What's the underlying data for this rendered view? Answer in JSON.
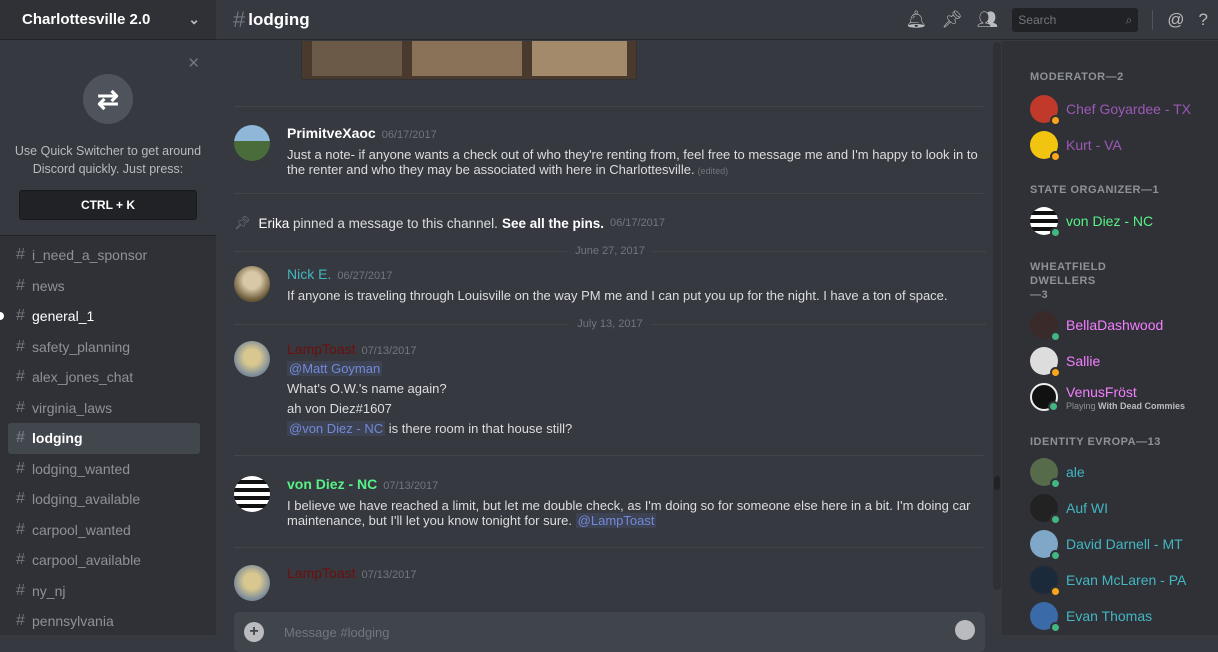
{
  "server": {
    "name": "Charlottesville 2.0"
  },
  "quick_switcher": {
    "text": "Use Quick Switcher to get around Discord quickly. Just press:",
    "shortcut": "CTRL + K"
  },
  "channels": [
    {
      "name": "i_need_a_sponsor"
    },
    {
      "name": "news"
    },
    {
      "name": "general_1",
      "unread": true
    },
    {
      "name": "safety_planning"
    },
    {
      "name": "alex_jones_chat"
    },
    {
      "name": "virginia_laws"
    },
    {
      "name": "lodging",
      "active": true
    },
    {
      "name": "lodging_wanted"
    },
    {
      "name": "lodging_available"
    },
    {
      "name": "carpool_wanted"
    },
    {
      "name": "carpool_available"
    },
    {
      "name": "ny_nj"
    },
    {
      "name": "pennsylvania"
    }
  ],
  "channel": {
    "name": "lodging"
  },
  "search": {
    "placeholder": "Search"
  },
  "messages": [
    {
      "author": "PrimitveXaoc",
      "time": "06/17/2017",
      "color": "#ffffff",
      "text": "Just a note- if anyone wants a check out of who they're renting from, feel free to message me and I'm happy to look in to the renter and who they may be associated with here in Charlottesville.",
      "edited": "(edited)"
    },
    {
      "author": "Nick E.",
      "time": "06/27/2017",
      "color": "#43b6c2",
      "text": "If anyone is traveling through Louisville on the way PM me and I can put you up for the night. I have a ton of space."
    },
    {
      "author": "LampToast",
      "time": "07/13/2017",
      "color": "#6b0f0f",
      "mention1": "@Matt Goyman",
      "l2": "What's O.W.'s name again?",
      "l3": "ah von Diez#1607",
      "mention2": "@von Diez - NC",
      "l4": "is there room in that house still?"
    },
    {
      "author": "von Diez - NC",
      "time": "07/13/2017",
      "color": "#57f287",
      "text": "I believe we have reached a limit, but let me double check, as I'm doing so for someone else here in a bit. I'm doing car maintenance, but I'll let you know tonight for sure.",
      "mention": "@LampToast"
    },
    {
      "author": "LampToast",
      "time": "07/13/2017",
      "color": "#6b0f0f"
    }
  ],
  "system": {
    "user": "Erika",
    "text": "pinned a message to this channel.",
    "link": "See all the pins.",
    "time": "06/17/2017"
  },
  "dates": [
    "June 27, 2017",
    "July 13, 2017"
  ],
  "composer": {
    "placeholder": "Message #lodging"
  },
  "roles": [
    {
      "title": "MODERATOR—2",
      "members": [
        {
          "name": "Chef Goyardee - TX",
          "color": "#9b59b6",
          "status": "#faa61a"
        },
        {
          "name": "Kurt - VA",
          "color": "#9b59b6",
          "status": "#faa61a"
        }
      ]
    },
    {
      "title": "STATE ORGANIZER—1",
      "members": [
        {
          "name": "von Diez - NC",
          "color": "#57f287",
          "status": "#43b581"
        }
      ]
    },
    {
      "title": "WHEATFIELD DWELLERS—3",
      "members": [
        {
          "name": "BellaDashwood",
          "color": "#f47fff",
          "status": "#43b581"
        },
        {
          "name": "Sallie",
          "color": "#f47fff",
          "status": "#faa61a"
        },
        {
          "name": "VenusFröst",
          "color": "#f47fff",
          "status": "#43b581",
          "activity": "Playing",
          "game": "With Dead Commies"
        }
      ]
    },
    {
      "title": "IDENTITY EVROPA—13",
      "members": [
        {
          "name": "ale",
          "color": "#43b6c2",
          "status": "#43b581"
        },
        {
          "name": "Auf WI",
          "color": "#43b6c2",
          "status": "#43b581"
        },
        {
          "name": "David Darnell - MT",
          "color": "#43b6c2",
          "status": "#43b581"
        },
        {
          "name": "Evan McLaren - PA",
          "color": "#43b6c2",
          "status": "#faa61a"
        },
        {
          "name": "Evan Thomas",
          "color": "#43b6c2",
          "status": "#43b581"
        }
      ]
    }
  ]
}
